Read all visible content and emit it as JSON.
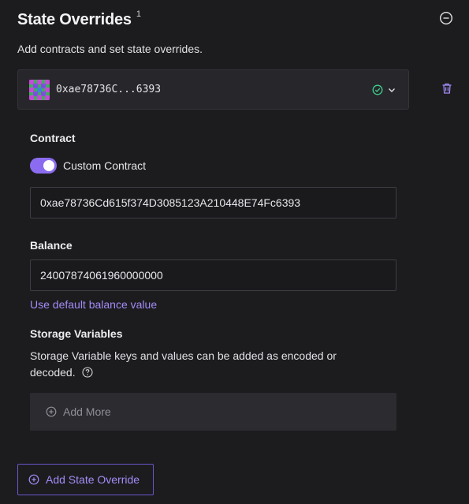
{
  "header": {
    "title": "State Overrides",
    "count": "1",
    "collapse_icon": "minus-circle-icon",
    "subtitle": "Add contracts and set state overrides."
  },
  "contract_select": {
    "address_short": "0xae78736C...6393",
    "status_icon": "check-circle-icon",
    "chevron_icon": "chevron-down-icon",
    "delete_icon": "trash-icon"
  },
  "contract_section": {
    "label": "Contract",
    "toggle_label": "Custom Contract",
    "toggle_on": true,
    "address_value": "0xae78736Cd615f374D3085123A210448E74Fc6393"
  },
  "balance_section": {
    "label": "Balance",
    "value": "24007874061960000000",
    "default_link": "Use default balance value"
  },
  "storage_section": {
    "label": "Storage Variables",
    "description": "Storage Variable keys and values can be added as encoded or decoded.",
    "help_icon": "question-circle-icon",
    "add_more_label": "Add More"
  },
  "footer": {
    "add_override_label": "Add State Override"
  },
  "colors": {
    "accent": "#8b6cf0",
    "link": "#a48bf5",
    "success": "#3ecf8e",
    "danger": "#a48bf5"
  }
}
